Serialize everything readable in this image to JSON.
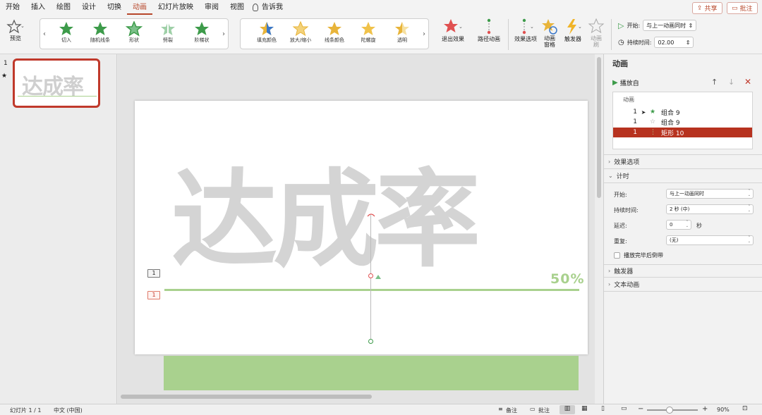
{
  "menu": {
    "items": [
      "开始",
      "插入",
      "绘图",
      "设计",
      "切换",
      "动画",
      "幻灯片放映",
      "审阅",
      "视图"
    ],
    "active_index": 5,
    "tell_me": "告诉我"
  },
  "top_buttons": {
    "share": "共享",
    "comment": "批注"
  },
  "ribbon": {
    "preview": "预览",
    "entrance_effects": [
      "切入",
      "随机线条",
      "形状",
      "劈裂",
      "阶梯状"
    ],
    "emphasis_effects": [
      "填充颜色",
      "放大/缩小",
      "线条颜色",
      "陀螺旋",
      "透明"
    ],
    "exit_effects": "退出效果",
    "path_animation": "路径动画",
    "effect_options": "效果选项",
    "animation_pane": "动画\n窗格",
    "trigger": "触发器",
    "animation_painter": "动画\n刷",
    "start_label": "开始:",
    "start_value": "与上一动画同时",
    "duration_label": "持续时间:",
    "duration_value": "02.00",
    "colors": {
      "entrance_green": "#3d9b4a",
      "emphasis_gold": "#e8b43a",
      "exit_red": "#e05050",
      "accent": "#b7472a"
    }
  },
  "thumbnails": [
    {
      "number": "1",
      "star": "★",
      "text": "达成率"
    }
  ],
  "slide": {
    "title_text": "达成率",
    "percent_text": "50%",
    "anim_tags": [
      "1",
      "1"
    ],
    "green_bar_color": "#a9d18e",
    "text_color": "#d4d4d4"
  },
  "animation_pane": {
    "title": "动画",
    "play_from": "播放自",
    "list_header": "动画",
    "items": [
      {
        "order": "1",
        "name": "组合 9",
        "selected": false
      },
      {
        "order": "1",
        "name": "组合 9",
        "selected": false
      },
      {
        "order": "1",
        "name": "矩形 10",
        "selected": true
      }
    ],
    "sections": {
      "effect_options": "效果选项",
      "timing": "计时",
      "trigger": "触发器",
      "text_animation": "文本动画"
    },
    "timing": {
      "start_label": "开始:",
      "start_value": "与上一动画同时",
      "duration_label": "持续时间:",
      "duration_value": "2 秒 (中)",
      "delay_label": "延迟:",
      "delay_value": "0",
      "delay_unit": "秒",
      "repeat_label": "重复:",
      "repeat_value": "(无)",
      "rewind_label": "播放完毕后倒带"
    }
  },
  "status": {
    "slide_label": "幻灯片 1 / 1",
    "language": "中文 (中国)",
    "notes": "备注",
    "comments": "批注",
    "zoom": "90%"
  }
}
